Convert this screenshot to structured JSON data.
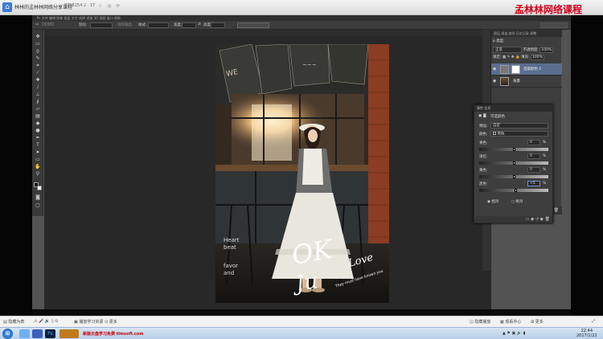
{
  "appbar": {
    "title": "林林的孟林林网络分享课程",
    "meta": "8798254 2 · 17",
    "watermark": "孟林林网络课程"
  },
  "options": {
    "feather_label": "羽化:",
    "feather_value": "0 像素",
    "antialias": "消除锯齿",
    "style_label": "样式:",
    "style_value": "正常",
    "width_label": "宽度:",
    "height_label": "高度:",
    "refine": "调整边缘...",
    "workspace": "基本功能"
  },
  "layers_panel": {
    "tabs": "图层  通道  路径  历史记录  调整",
    "kind": "p 类型",
    "blend": "正常",
    "opacity_label": "不透明度:",
    "opacity": "100%",
    "lock_label": "锁定:",
    "fill_label": "填充:",
    "fill": "100%",
    "layers": [
      {
        "name": "选取颜色 1",
        "selected": true
      },
      {
        "name": "背景",
        "selected": false
      }
    ]
  },
  "properties": {
    "tabs": "属性  信息",
    "title": "可选颜色",
    "preset_label": "预设:",
    "preset_value": "自定",
    "colors_label": "颜色:",
    "colors_value": "黑色",
    "rows": [
      {
        "label": "青色:",
        "value": "0",
        "unit": "%"
      },
      {
        "label": "洋红:",
        "value": "0",
        "unit": "%"
      },
      {
        "label": "黄色:",
        "value": "0",
        "unit": "%"
      },
      {
        "label": "黑色:",
        "value": "+5",
        "unit": "%"
      }
    ],
    "relative": "相对",
    "absolute": "绝对"
  },
  "player": {
    "left": "隐藏为表",
    "mid": "播放学习资源",
    "mid2": "更多",
    "right": "隐藏播放",
    "right2": "观看中心",
    "right3": "更多"
  },
  "taskbar": {
    "ad": "新版云盘学习免费 tlmsoft.com",
    "time": "22:44",
    "date": "2017/1/22"
  },
  "photo_text": {
    "ok": "OK",
    "love": "Love",
    "ju": "Ju",
    "small": "They must have known you",
    "left1": "Heart",
    "left2": "beat",
    "left3": "favor",
    "left4": "and"
  }
}
